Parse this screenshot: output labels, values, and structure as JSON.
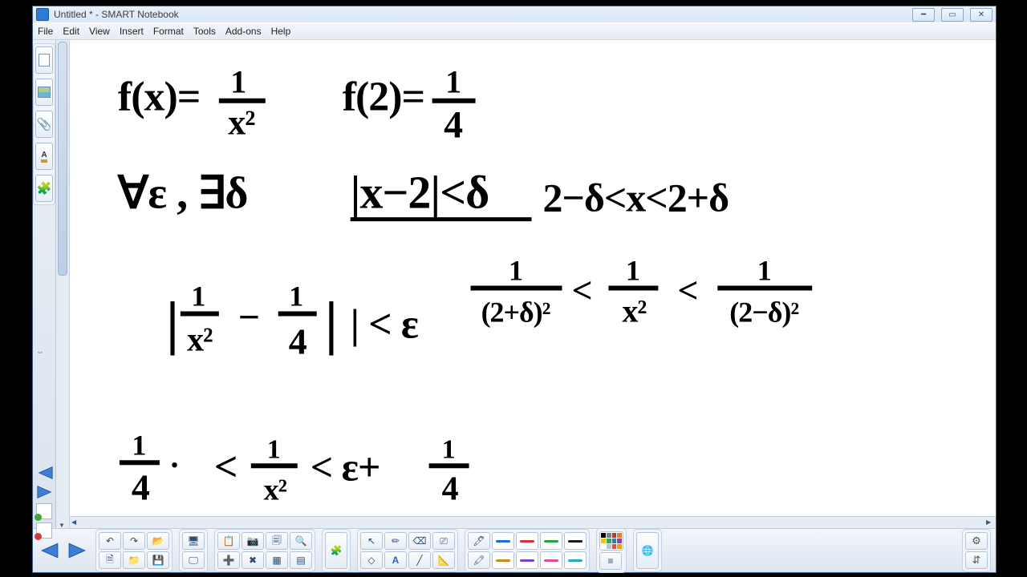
{
  "title": "Untitled * - SMART Notebook",
  "menu": [
    "File",
    "Edit",
    "View",
    "Insert",
    "Format",
    "Tools",
    "Add-ons",
    "Help"
  ],
  "left_tools": {
    "blank_page": "Blank page",
    "picture": "Picture",
    "attachment": "Attachment",
    "text_style": "A",
    "puzzle": "Add-on"
  },
  "pen_colors": [
    "#1b6fd4",
    "#d33535",
    "#27a33b",
    "#1a1a1a",
    "#c48c1d",
    "#7d3ec7",
    "#d94fa0",
    "#2aa6c9"
  ],
  "palette": [
    "#000",
    "#7f7f7f",
    "#c0392b",
    "#e67e22",
    "#f1c40f",
    "#27ae60",
    "#2980b9",
    "#8e44ad",
    "#fff",
    "#bdc3c7",
    "#e74c3c",
    "#f39c12"
  ],
  "ink": {
    "line1a": "f(x)=",
    "line1a_num": "1",
    "line1a_den": "x²",
    "line1b": "f(2)=",
    "line1b_num": "1",
    "line1b_den": "4",
    "line2a": "∀ε , ∃δ",
    "line2b": "|x−2|<δ",
    "line2c": "2−δ<x<2+δ",
    "line3a_open": "|",
    "line3a_num1": "1",
    "line3a_den1": "x²",
    "line3a_mid": "−",
    "line3a_num2": "1",
    "line3a_den2": "4",
    "line3a_close": "| < ε",
    "line3b_num1": "1",
    "line3b_den1": "(2+δ)²",
    "line3b_mid1": "<",
    "line3b_num2": "1",
    "line3b_den2": "x²",
    "line3b_mid2": "<",
    "line3b_num3": "1",
    "line3b_den3": "(2−δ)²",
    "line4a_num": "1",
    "line4a_den": "4",
    "line4a_dot": "·",
    "line4_mid1": "<",
    "line4b_num": "1",
    "line4b_den": "x²",
    "line4_mid2": "< ε+",
    "line4c_num": "1",
    "line4c_den": "4"
  }
}
